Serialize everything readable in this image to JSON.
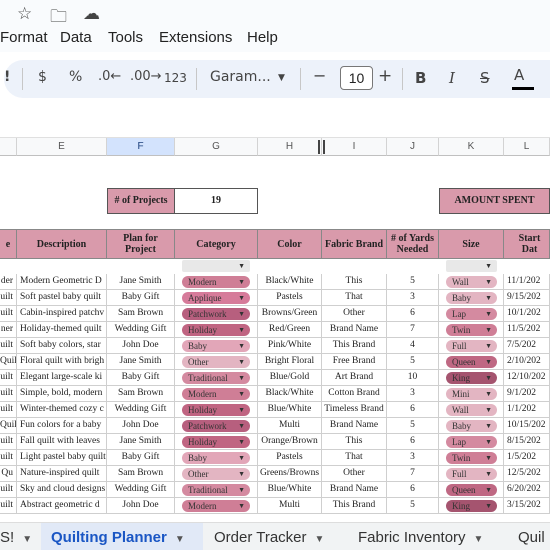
{
  "top_icons": [
    "star-icon",
    "move-to-folder-icon",
    "cloud-saved-icon"
  ],
  "menu": [
    "Format",
    "Data",
    "Tools",
    "Extensions",
    "Help"
  ],
  "toolbar": {
    "currency": "$",
    "percent": "%",
    "dec_decrease": ".0←",
    "dec_increase": ".00→",
    "number_format": "123",
    "font": "Garam...",
    "minus": "−",
    "font_size": "10",
    "plus": "+",
    "bold": "B",
    "italic": "I",
    "strike": "S",
    "text_color": "A"
  },
  "columns": [
    "E",
    "F",
    "G",
    "H",
    "I",
    "J",
    "K",
    "L"
  ],
  "selected_column": "F",
  "summary": {
    "projects_label": "# of Projects",
    "projects_value": "19",
    "amount_label": "AMOUNT SPENT"
  },
  "headers": {
    "d": "e",
    "e": "Description",
    "f": "Plan for Project",
    "g": "Category",
    "h": "Color",
    "i": "Fabric Brand",
    "j": "# of Yards Needed",
    "k": "Size",
    "l": "Start Dat"
  },
  "rows": [
    {
      "d": "der",
      "e": "Modern Geometric D",
      "f": "Jane Smith",
      "g": "Modern",
      "h": "Black/White",
      "i": "This",
      "j": "5",
      "k": "Wall",
      "l": "11/1/202"
    },
    {
      "d": "uilt",
      "e": "Soft pastel baby quilt",
      "f": "Baby Gift",
      "g": "Applique",
      "h": "Pastels",
      "i": "That",
      "j": "3",
      "k": "Baby",
      "l": "9/15/202"
    },
    {
      "d": "uilt",
      "e": "Cabin-inspired patchv",
      "f": "Sam Brown",
      "g": "Patchwork",
      "h": "Browns/Green",
      "i": "Other",
      "j": "6",
      "k": "Lap",
      "l": "10/1/202"
    },
    {
      "d": "ner",
      "e": "Holiday-themed quilt",
      "f": "Wedding Gift",
      "g": "Holiday",
      "h": "Red/Green",
      "i": "Brand Name",
      "j": "7",
      "k": "Twin",
      "l": "11/5/202"
    },
    {
      "d": "uilt",
      "e": "Soft baby colors, star",
      "f": "John Doe",
      "g": "Baby",
      "h": "Pink/White",
      "i": "This Brand",
      "j": "4",
      "k": "Full",
      "l": "7/5/202"
    },
    {
      "d": "Quilt",
      "e": "Floral quilt with brigh",
      "f": "Jane Smith",
      "g": "Other",
      "h": "Bright Floral",
      "i": "Free Brand",
      "j": "5",
      "k": "Queen",
      "l": "2/10/202"
    },
    {
      "d": "uilt",
      "e": "Elegant large-scale ki",
      "f": "Baby Gift",
      "g": "Traditional",
      "h": "Blue/Gold",
      "i": "Art Brand",
      "j": "10",
      "k": "King",
      "l": "12/10/202"
    },
    {
      "d": "uilt",
      "e": "Simple, bold, modern",
      "f": "Sam Brown",
      "g": "Modern",
      "h": "Black/White",
      "i": "Cotton Brand",
      "j": "3",
      "k": "Mini",
      "l": "9/1/202"
    },
    {
      "d": "uilt",
      "e": "Winter-themed cozy c",
      "f": "Wedding Gift",
      "g": "Holiday",
      "h": "Blue/White",
      "i": "Timeless Brand",
      "j": "6",
      "k": "Wall",
      "l": "1/1/202"
    },
    {
      "d": "Quilt",
      "e": "Fun colors for a baby",
      "f": "John Doe",
      "g": "Patchwork",
      "h": "Multi",
      "i": "Brand Name",
      "j": "5",
      "k": "Baby",
      "l": "10/15/202"
    },
    {
      "d": "uilt",
      "e": "Fall quilt with leaves",
      "f": "Jane Smith",
      "g": "Holiday",
      "h": "Orange/Brown",
      "i": "This",
      "j": "6",
      "k": "Lap",
      "l": "8/15/202"
    },
    {
      "d": "uilt",
      "e": "Light pastel baby quilt",
      "f": "Baby Gift",
      "g": "Baby",
      "h": "Pastels",
      "i": "That",
      "j": "3",
      "k": "Twin",
      "l": "1/5/202"
    },
    {
      "d": "Qu",
      "e": "Nature-inspired quilt",
      "f": "Sam Brown",
      "g": "Other",
      "h": "Greens/Browns",
      "i": "Other",
      "j": "7",
      "k": "Full",
      "l": "12/5/202"
    },
    {
      "d": "uilt",
      "e": "Sky and cloud designs",
      "f": "Wedding Gift",
      "g": "Traditional",
      "h": "Blue/White",
      "i": "Brand Name",
      "j": "6",
      "k": "Queen",
      "l": "6/20/202"
    },
    {
      "d": "uilt",
      "e": "Abstract geometric d",
      "f": "John Doe",
      "g": "Modern",
      "h": "Multi",
      "i": "This Brand",
      "j": "5",
      "k": "King",
      "l": "3/15/202"
    }
  ],
  "tabs": [
    {
      "label": "S!",
      "dropdown": true
    },
    {
      "label": "Quilting Planner",
      "dropdown": true,
      "active": true
    },
    {
      "label": "Order Tracker",
      "dropdown": true
    },
    {
      "label": "Fabric Inventory",
      "dropdown": true
    },
    {
      "label": "Quil",
      "dropdown": false
    }
  ]
}
